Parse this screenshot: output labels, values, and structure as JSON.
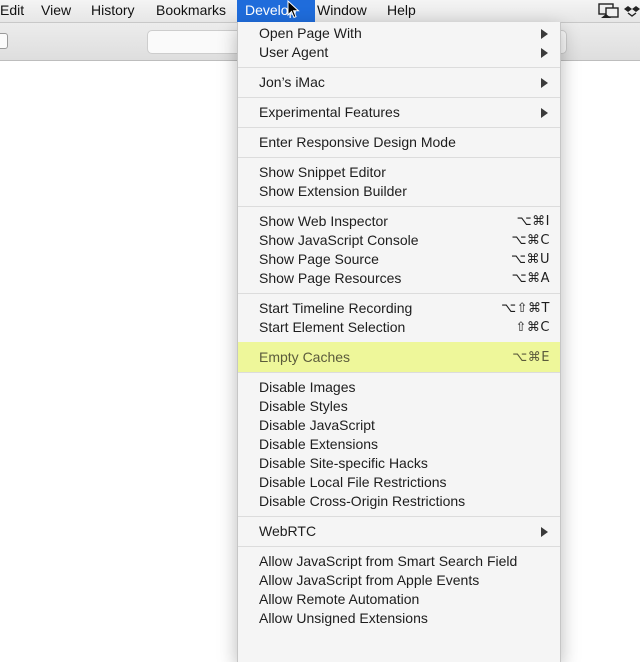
{
  "menubar": {
    "items": [
      {
        "label": "Edit"
      },
      {
        "label": "View"
      },
      {
        "label": "History"
      },
      {
        "label": "Bookmarks"
      },
      {
        "label": "Develop",
        "active": true
      },
      {
        "label": "Window"
      },
      {
        "label": "Help"
      }
    ],
    "status_icons": [
      "airplay-display-icon",
      "dropbox-icon"
    ]
  },
  "develop_menu": {
    "groups": [
      [
        {
          "label": "Open Page With",
          "submenu": true
        },
        {
          "label": "User Agent",
          "submenu": true
        }
      ],
      [
        {
          "label": "Jon’s iMac",
          "submenu": true
        }
      ],
      [
        {
          "label": "Experimental Features",
          "submenu": true
        }
      ],
      [
        {
          "label": "Enter Responsive Design Mode"
        }
      ],
      [
        {
          "label": "Show Snippet Editor"
        },
        {
          "label": "Show Extension Builder"
        }
      ],
      [
        {
          "label": "Show Web Inspector",
          "shortcut": "⌥⌘I"
        },
        {
          "label": "Show JavaScript Console",
          "shortcut": "⌥⌘C"
        },
        {
          "label": "Show Page Source",
          "shortcut": "⌥⌘U"
        },
        {
          "label": "Show Page Resources",
          "shortcut": "⌥⌘A"
        }
      ],
      [
        {
          "label": "Start Timeline Recording",
          "shortcut": "⌥⇧⌘T"
        },
        {
          "label": "Start Element Selection",
          "shortcut": "⇧⌘C"
        }
      ],
      [
        {
          "label": "Empty Caches",
          "shortcut": "⌥⌘E",
          "highlighted": true
        }
      ],
      [
        {
          "label": "Disable Images"
        },
        {
          "label": "Disable Styles"
        },
        {
          "label": "Disable JavaScript"
        },
        {
          "label": "Disable Extensions"
        },
        {
          "label": "Disable Site-specific Hacks"
        },
        {
          "label": "Disable Local File Restrictions"
        },
        {
          "label": "Disable Cross-Origin Restrictions"
        }
      ],
      [
        {
          "label": "WebRTC",
          "submenu": true
        }
      ],
      [
        {
          "label": "Allow JavaScript from Smart Search Field"
        },
        {
          "label": "Allow JavaScript from Apple Events"
        },
        {
          "label": "Allow Remote Automation"
        },
        {
          "label": "Allow Unsigned Extensions"
        }
      ]
    ]
  },
  "colors": {
    "menu_active": "#1f6cdb",
    "highlight": "#eef79a",
    "menu_background": "#f5f5f5"
  }
}
